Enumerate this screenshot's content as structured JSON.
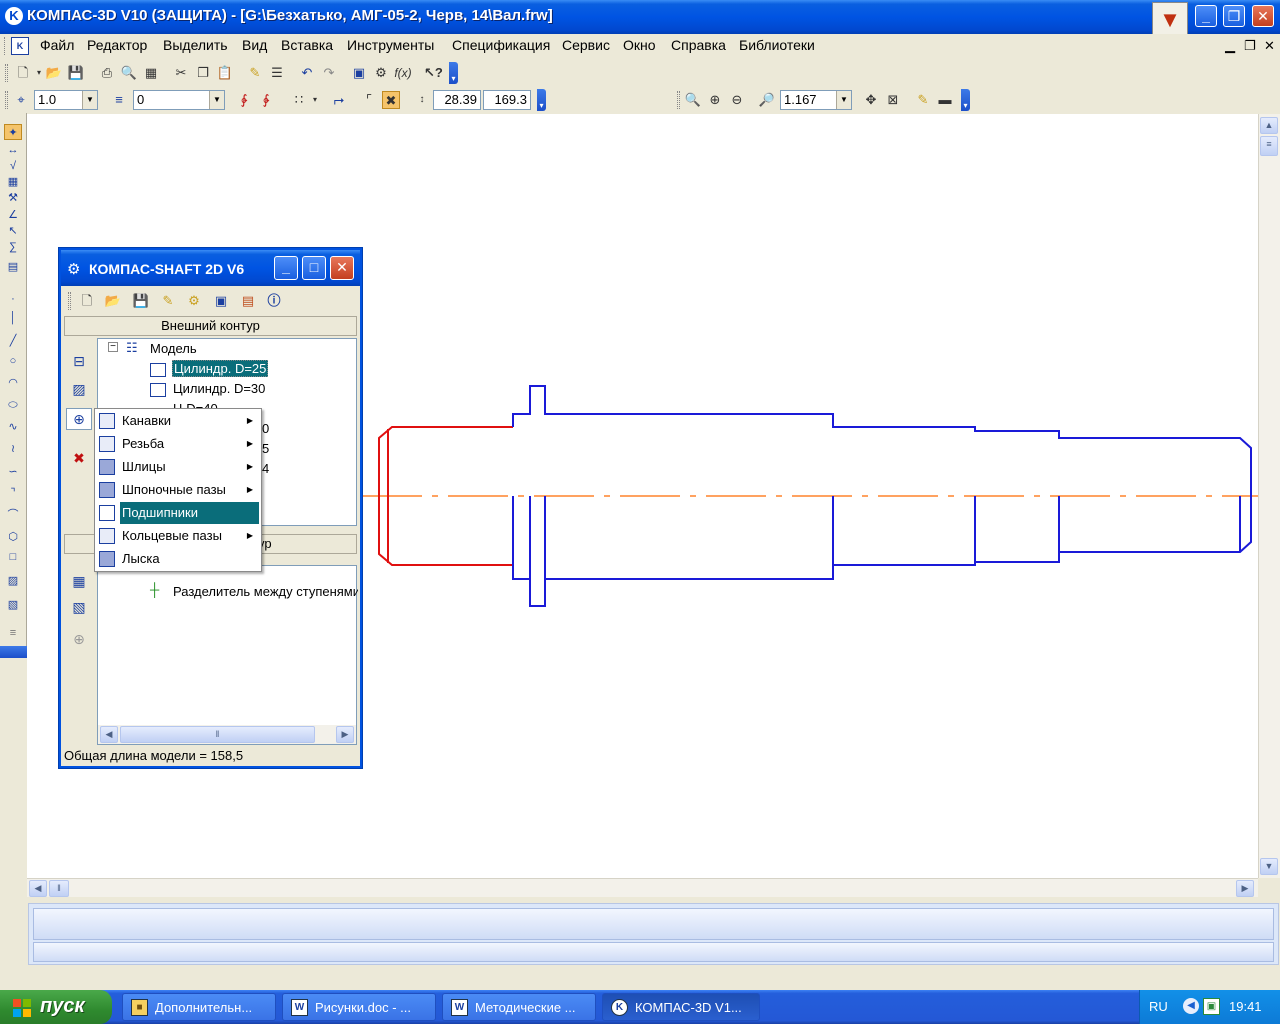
{
  "window": {
    "title": "КОМПАС-3D V10 (ЗАЩИТА) - [G:\\Безхатько, АМГ-05-2, Черв, 14\\Вал.frw]"
  },
  "menubar": {
    "items": [
      "Файл",
      "Редактор",
      "Выделить",
      "Вид",
      "Вставка",
      "Инструменты",
      "Спецификация",
      "Сервис",
      "Окно",
      "Справка",
      "Библиотеки"
    ]
  },
  "toolbar2": {
    "step_value": "1.0",
    "layer_value": "0",
    "coord_x": "28.39",
    "coord_y": "169.3",
    "zoom_value": "1.167"
  },
  "shaft_window": {
    "title": "КОМПАС-SHAFT 2D V6",
    "outer_contour_header": "Внешний контур",
    "tree": {
      "root": "Модель",
      "items": [
        "Цилиндр. D=25",
        "Цилиндр. D=30"
      ]
    },
    "partial_items": [
      "Ц     D=40",
      "0",
      "5",
      "4"
    ],
    "inner_contour_header_partial": "ур",
    "inner_tree_item": "Разделитель между ступенями",
    "status": "Общая длина модели = 158,5"
  },
  "context_menu": {
    "items": [
      {
        "label": "Канавки",
        "submenu": true
      },
      {
        "label": "Резьба",
        "submenu": true
      },
      {
        "label": "Шлицы",
        "submenu": true
      },
      {
        "label": "Шпоночные пазы",
        "submenu": true
      },
      {
        "label": "Подшипники",
        "submenu": false
      },
      {
        "label": "Кольцевые пазы",
        "submenu": true
      },
      {
        "label": "Лыска",
        "submenu": false
      }
    ]
  },
  "taskbar": {
    "start_label": "пуск",
    "tasks": [
      "Дополнительн...",
      "Рисунки.doc - ...",
      "Методические ...",
      "КОМПАС-3D V1..."
    ],
    "lang": "RU",
    "time": "19:41"
  },
  "colors": {
    "shaft_contour": "#1a1ad8",
    "selected_segment": "#e01010",
    "axis_line": "#ff6a00",
    "highlight": "#0a6d7a"
  }
}
